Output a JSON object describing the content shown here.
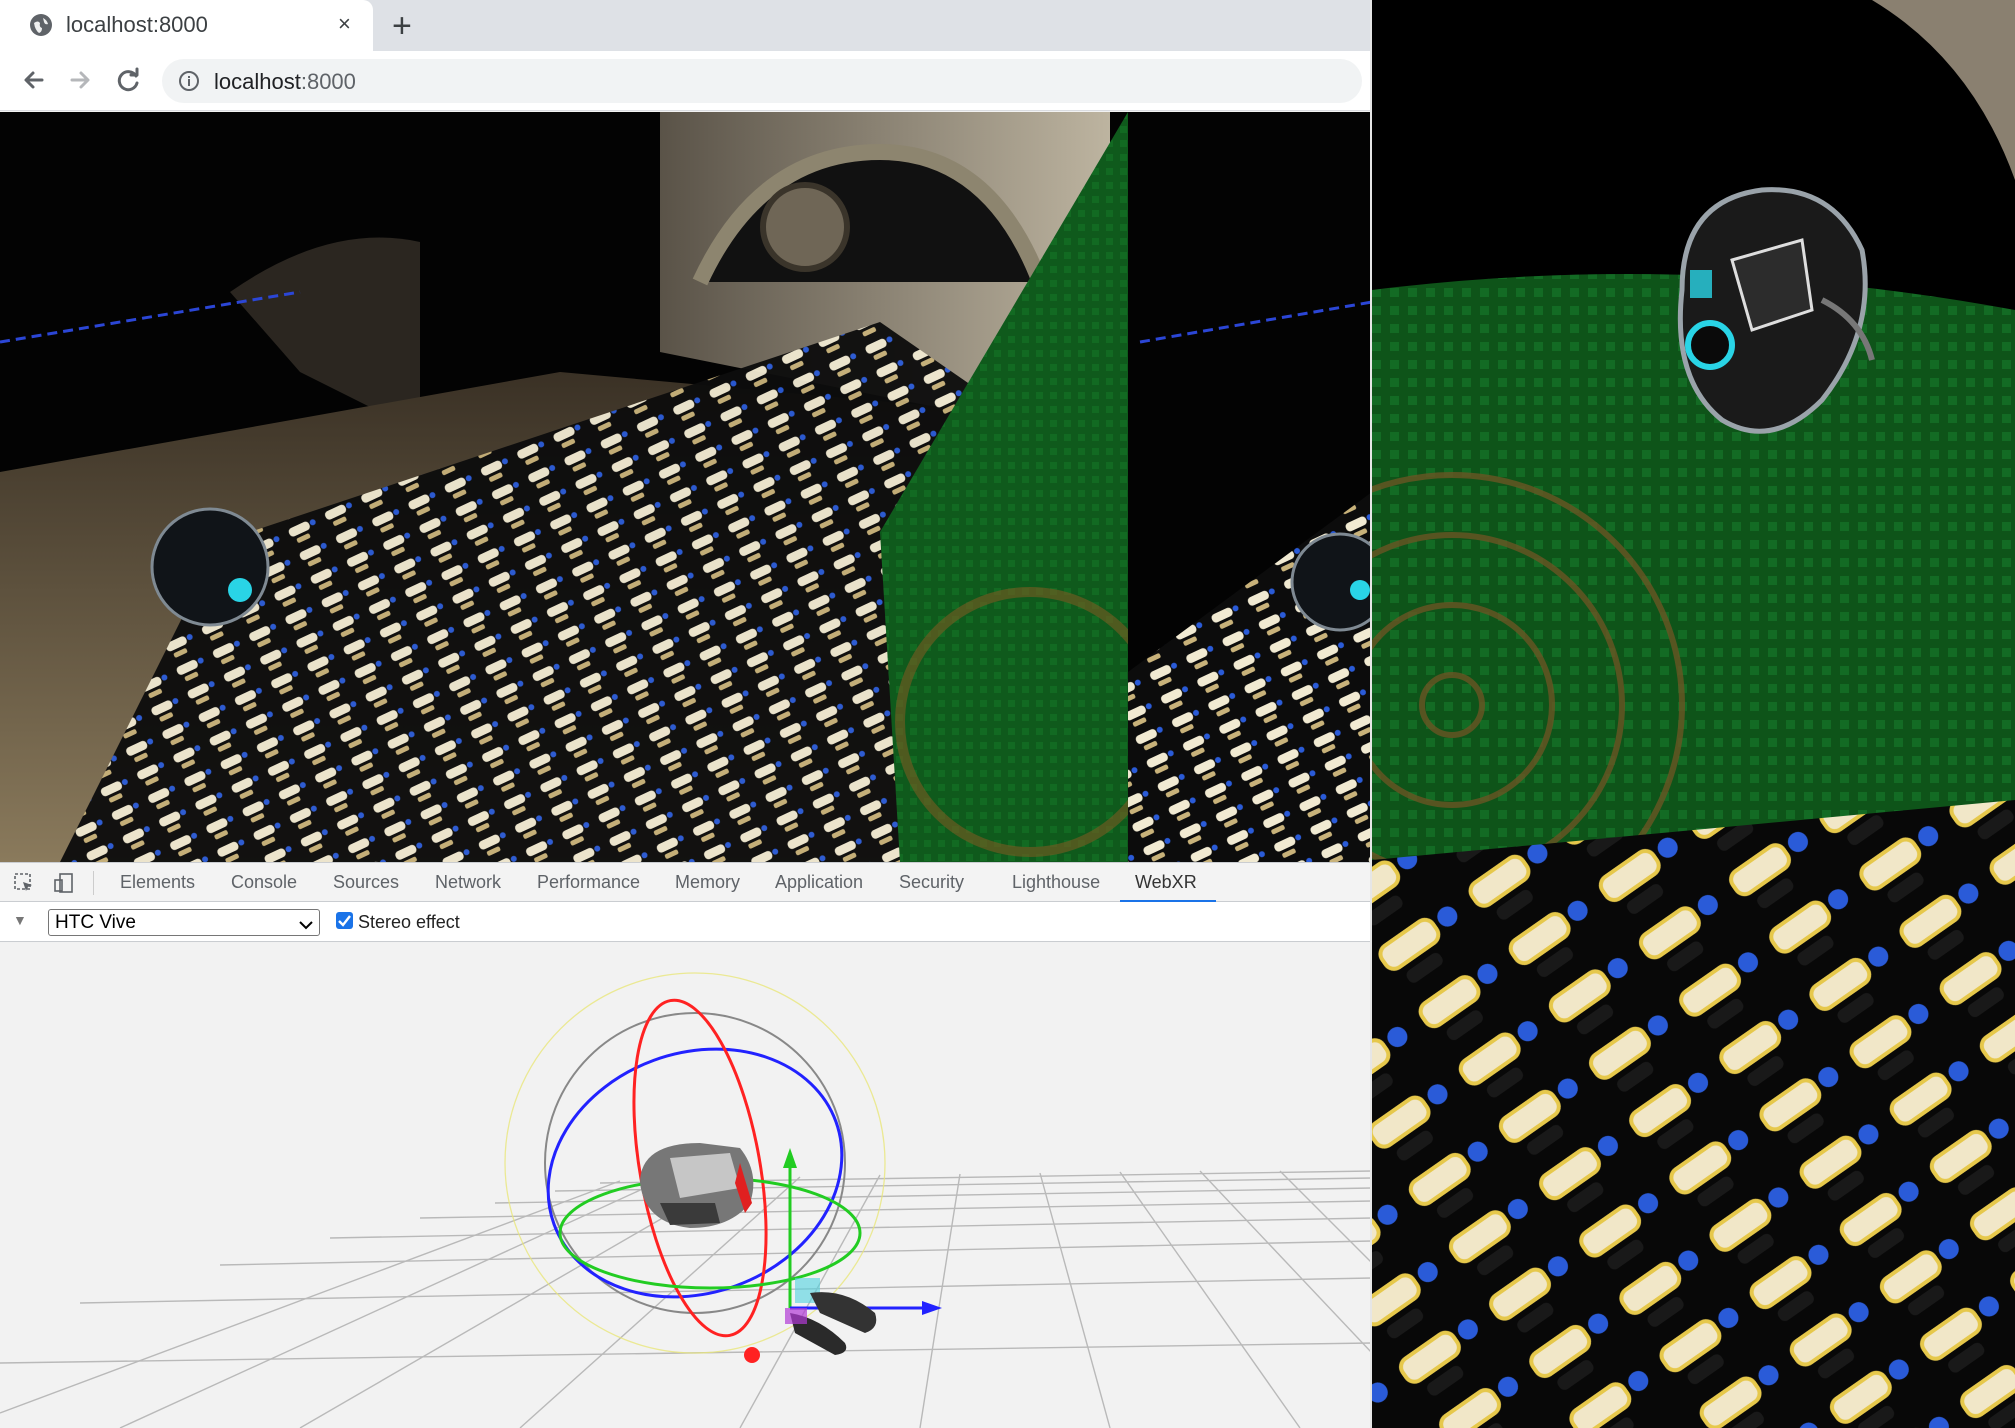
{
  "browser": {
    "tab_title": "localhost:8000",
    "tab_close_glyph": "×",
    "new_tab_glyph": "+",
    "url_host": "localhost",
    "url_port": ":8000",
    "icons": {
      "favicon": "globe-icon",
      "back": "arrow-left-icon",
      "forward": "arrow-right-icon",
      "reload": "reload-icon",
      "site_info": "info-icon"
    }
  },
  "devtools": {
    "tabs": [
      {
        "label": "Elements"
      },
      {
        "label": "Console"
      },
      {
        "label": "Sources"
      },
      {
        "label": "Network"
      },
      {
        "label": "Performance"
      },
      {
        "label": "Memory"
      },
      {
        "label": "Application"
      },
      {
        "label": "Security"
      },
      {
        "label": "Lighthouse"
      },
      {
        "label": "WebXR"
      }
    ],
    "active_tab": "WebXR",
    "device_select": {
      "value": "HTC Vive"
    },
    "stereo_effect": {
      "label": "Stereo effect",
      "checked": true
    },
    "colors": {
      "active_underline": "#1a73e8",
      "axis_x": "#2222ff",
      "axis_y": "#22cc22",
      "axis_z": "#ff2222"
    }
  },
  "scene": {
    "description_icons": [
      "vr-headset-icon",
      "vr-controller-icon",
      "rotation-gizmo-icon"
    ]
  }
}
